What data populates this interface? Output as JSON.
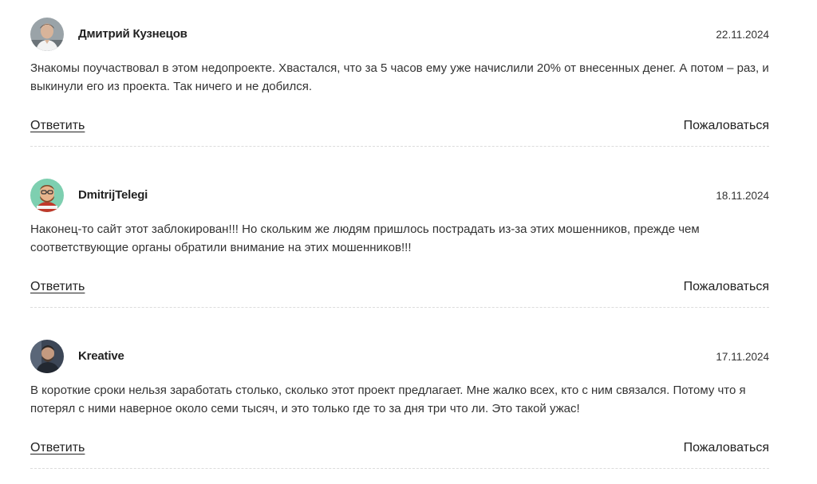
{
  "comments": [
    {
      "author": "Дмитрий Кузнецов",
      "date": "22.11.2024",
      "text": "Знакомы поучаствовал в этом недопроекте. Хвастался, что за 5 часов ему уже начислили 20% от внесенных денег. А потом – раз, и выкинули его из проекта. Так ничего и не добился.",
      "reply_label": "Ответить",
      "report_label": "Пожаловаться",
      "avatar": "user-photo-icon"
    },
    {
      "author": "DmitrijTelegi",
      "date": "18.11.2024",
      "text": "Наконец-то сайт этот заблокирован!!! Но скольким же людям пришлось пострадать из-за этих мошенников, прежде чем соответствующие органы обратили внимание на этих мошенников!!!",
      "reply_label": "Ответить",
      "report_label": "Пожаловаться",
      "avatar": "cartoon-avatar-icon"
    },
    {
      "author": "Kreative",
      "date": "17.11.2024",
      "text": "В короткие сроки нельзя заработать столько, сколько этот проект предлагает. Мне жалко всех, кто с ним связался. Потому что я потерял с ними наверное около семи тысяч, и это только где то за дня три что ли. Это такой ужас!",
      "reply_label": "Ответить",
      "report_label": "Пожаловаться",
      "avatar": "user-photo-icon"
    }
  ],
  "colors": {
    "text": "#222222",
    "divider": "#dcdcdc"
  }
}
